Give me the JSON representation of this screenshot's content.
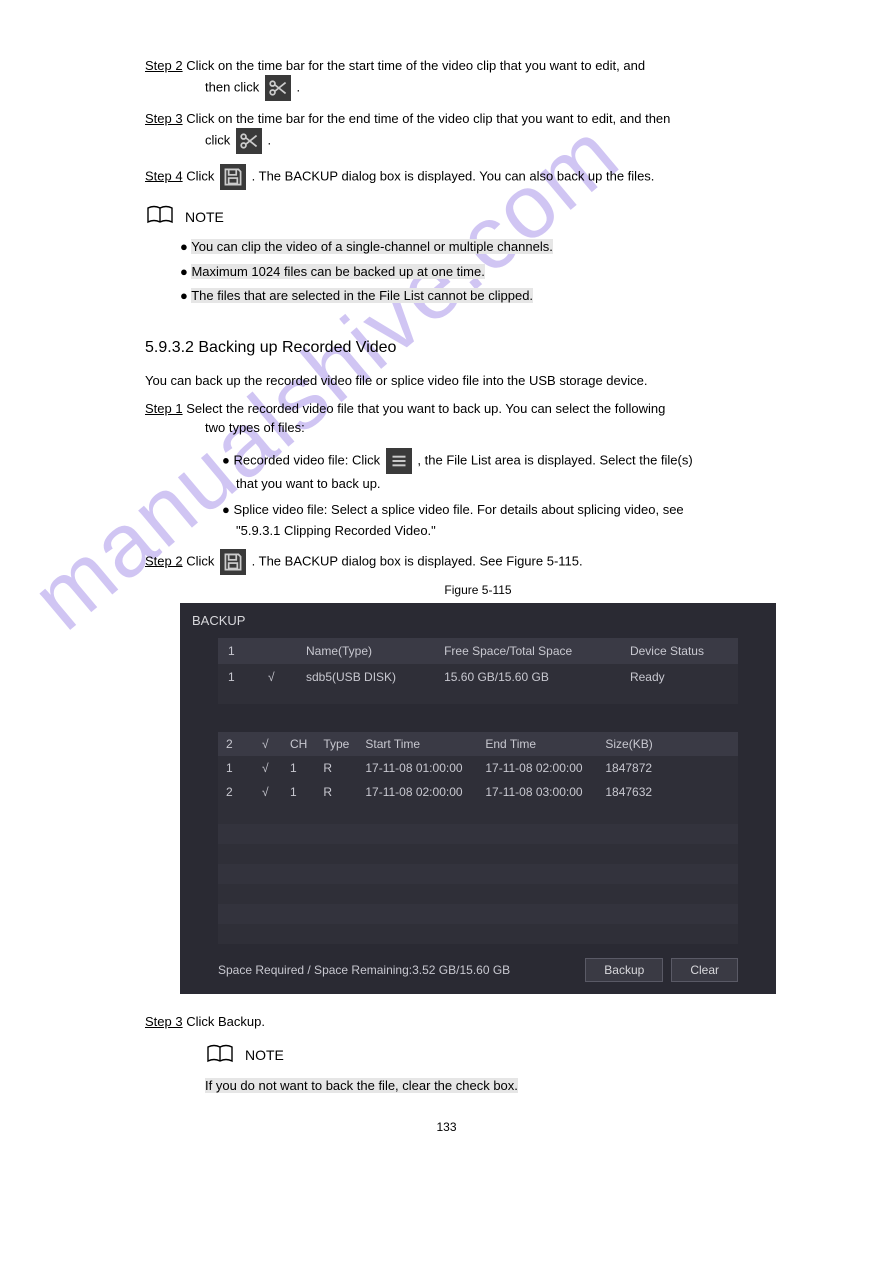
{
  "icons": {
    "scissors": "scissors-icon",
    "save": "save-icon",
    "book": "book-icon",
    "list": "list-icon"
  },
  "step2": {
    "label": "Step 2",
    "lines": [
      "Click on the time bar for the start time of the video clip that you want to edit, and",
      "then click"
    ],
    "icon_suffix": "."
  },
  "step3": {
    "label": "Step 3",
    "lines": [
      "Click on the time bar for the end time of the video clip that you want to edit, and then",
      "click"
    ],
    "icon_suffix": "."
  },
  "step4": {
    "label": "Step 4",
    "text": "Click",
    "icon_suffix": ". The BACKUP dialog box is displayed. You can also back up the files."
  },
  "note1": {
    "label": "NOTE",
    "bullets": [
      "You can clip the video of a single-channel or multiple channels.",
      "Maximum 1024 files can be backed up at one time.",
      "The files that are selected in the File List cannot be clipped."
    ]
  },
  "section_heading": "5.9.3.2 Backing up Recorded Video",
  "intro": "You can back up the recorded video file or splice video file into the USB storage device.",
  "bu_step1": {
    "label": "Step 1",
    "text": "Select the recorded video file that you want to back up. You can select the following",
    "text2": "two types of files:",
    "bullets": [
      {
        "lead": "Recorded video file: Click",
        "tail": ", the File List area is displayed. Select the file(s)",
        "tail2": "that you want to back up."
      },
      {
        "lead": "Splice video file: Select a splice video file. For details about splicing video, see",
        "tail": "",
        "link": "\"5.9.3.1 Clipping Recorded Video.\""
      }
    ]
  },
  "bu_step2": {
    "label": "Step 2",
    "text": "Click",
    "icon_suffix": ". The BACKUP dialog box is displayed. See Figure 5-115."
  },
  "figure_caption": "Figure 5-115",
  "backup_dialog": {
    "title": "BACKUP",
    "devices": {
      "headers": [
        "1",
        "",
        "Name(Type)",
        "Free Space/Total Space",
        "Device Status"
      ],
      "rows": [
        {
          "idx": "1",
          "checked": true,
          "name": "sdb5(USB DISK)",
          "space": "15.60 GB/15.60 GB",
          "status": "Ready"
        }
      ]
    },
    "files": {
      "count_label": "2",
      "headers": [
        "",
        "",
        "CH",
        "Type",
        "Start Time",
        "End Time",
        "Size(KB)"
      ],
      "rows": [
        {
          "idx": "1",
          "checked": true,
          "ch": "1",
          "type": "R",
          "start": "17-11-08 01:00:00",
          "end": "17-11-08 02:00:00",
          "size": "1847872"
        },
        {
          "idx": "2",
          "checked": true,
          "ch": "1",
          "type": "R",
          "start": "17-11-08 02:00:00",
          "end": "17-11-08 03:00:00",
          "size": "1847632"
        }
      ]
    },
    "footer": {
      "text": "Space Required / Space Remaining:3.52 GB/15.60 GB",
      "backup_btn": "Backup",
      "clear_btn": "Clear"
    }
  },
  "bu_step3": {
    "label": "Step 3",
    "text": "Click Backup."
  },
  "note2": {
    "label": "NOTE",
    "text": "If you do not want to back the file, clear the check box."
  },
  "page_number": "133",
  "watermark": "manualshive.com"
}
